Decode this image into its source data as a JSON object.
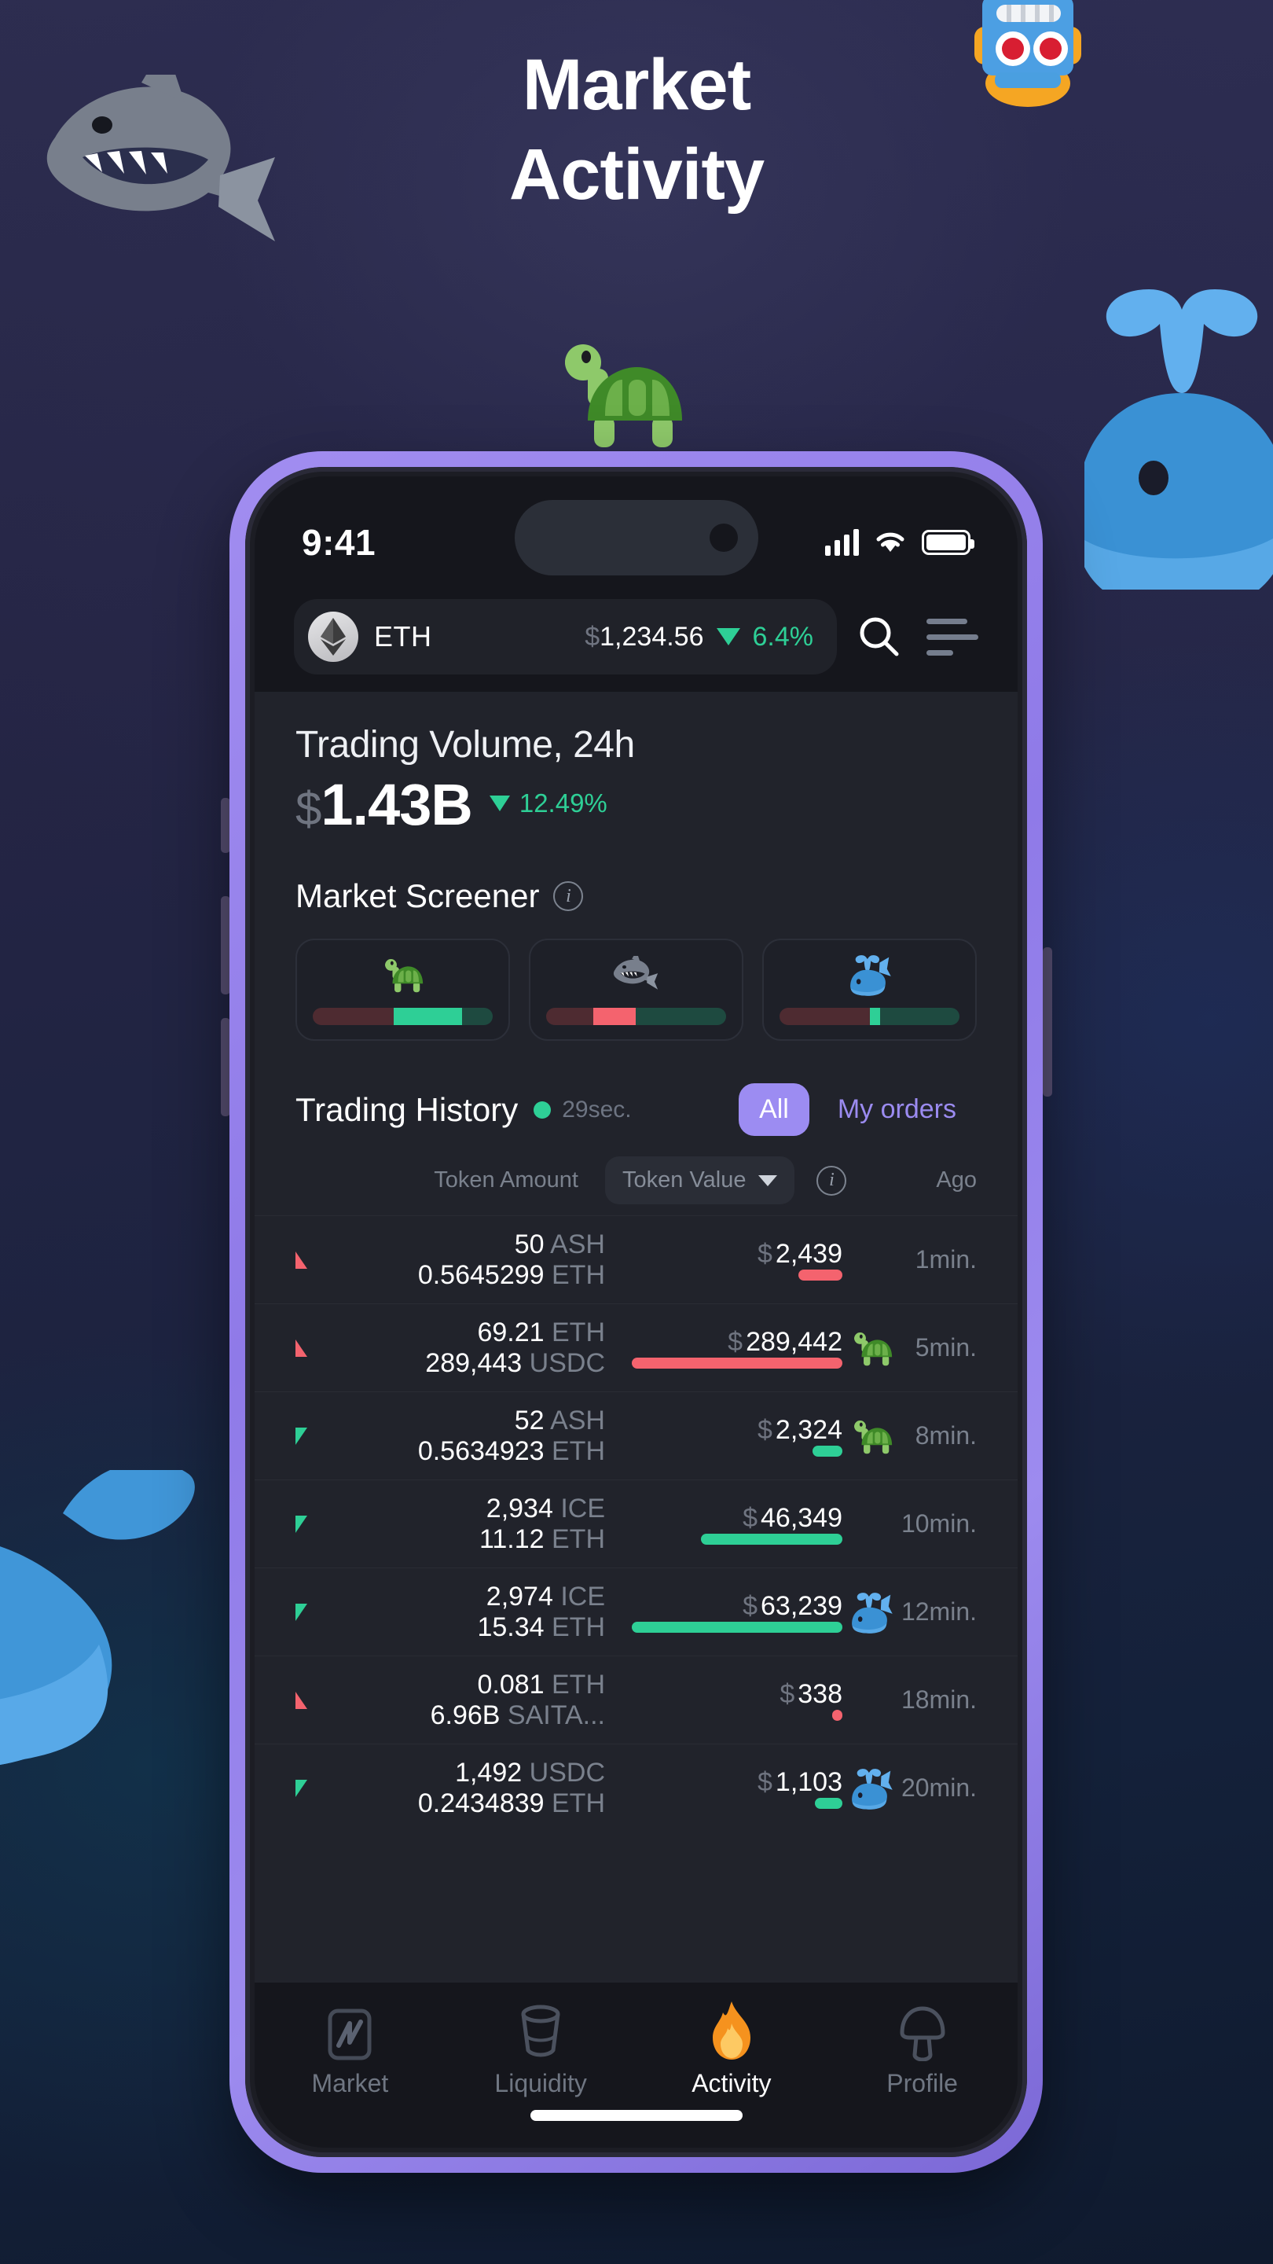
{
  "headline": {
    "line1": "Market",
    "line2": "Activity"
  },
  "decor": {
    "shark": "shark-illustration",
    "whale_right": "whale-illustration",
    "whale_left": "whale-illustration",
    "robot": "robot-illustration",
    "turtle": "turtle-illustration"
  },
  "colors": {
    "accent_purple": "#9c8cf2",
    "positive_green": "#2ecf96",
    "negative_red": "#f4636e",
    "screen_bg": "#21232b",
    "bar_bg": "#15161c"
  },
  "status_bar": {
    "time": "9:41",
    "signal": "cellular-bars-icon",
    "wifi": "wifi-icon",
    "battery": "battery-full-icon"
  },
  "top_bar": {
    "token_symbol": "ETH",
    "token_icon": "ethereum-icon",
    "currency": "$",
    "price": "1,234.56",
    "change": "6.4%",
    "change_direction": "down",
    "search_icon": "search-icon",
    "menu_icon": "hamburger-menu-icon"
  },
  "volume": {
    "title": "Trading Volume, 24h",
    "currency": "$",
    "value": "1.43B",
    "delta": "12.49%",
    "delta_direction": "down"
  },
  "screener": {
    "title": "Market Screener",
    "info_icon": "info-icon",
    "cards": [
      {
        "emoji": "turtle-icon",
        "neg_pct": 45,
        "hot_pct": 38,
        "hot_color": "#2ecf96",
        "pos_pct": 17
      },
      {
        "emoji": "shark-icon",
        "neg_pct": 26,
        "hot_pct": 24,
        "hot_color": "#f4636e",
        "pos_pct": 50
      },
      {
        "emoji": "whale-icon",
        "neg_pct": 50,
        "hot_pct": 6,
        "hot_color": "#2ecf96",
        "pos_pct": 44
      }
    ]
  },
  "history": {
    "title": "Trading History",
    "live_dot": "live-indicator",
    "timer": "29sec.",
    "tabs": [
      {
        "label": "All",
        "active": true
      },
      {
        "label": "My orders",
        "active": false
      }
    ],
    "columns": {
      "amount": "Token Amount",
      "value": "Token Value",
      "value_chevron": "chevron-down-icon",
      "info": "info-icon",
      "ago": "Ago"
    },
    "rows": [
      {
        "direction": "up",
        "amount_top": "50",
        "symbol_top": "ASH",
        "amount_bottom": "0.5645299",
        "symbol_bottom": "ETH",
        "currency": "$",
        "value": "2,439",
        "bar_width_pct": 21,
        "bar_color": "#f4636e",
        "creature": "",
        "ago": "1min."
      },
      {
        "direction": "up",
        "amount_top": "69.21",
        "symbol_top": "ETH",
        "amount_bottom": "289,443",
        "symbol_bottom": "USDC",
        "currency": "$",
        "value": "289,442",
        "bar_width_pct": 100,
        "bar_color": "#f4636e",
        "creature": "turtle-icon",
        "ago": "5min."
      },
      {
        "direction": "down",
        "amount_top": "52",
        "symbol_top": "ASH",
        "amount_bottom": "0.5634923",
        "symbol_bottom": "ETH",
        "currency": "$",
        "value": "2,324",
        "bar_width_pct": 14,
        "bar_color": "#2ecf96",
        "creature": "turtle-icon",
        "ago": "8min."
      },
      {
        "direction": "down",
        "amount_top": "2,934",
        "symbol_top": "ICE",
        "amount_bottom": "11.12",
        "symbol_bottom": "ETH",
        "currency": "$",
        "value": "46,349",
        "bar_width_pct": 67,
        "bar_color": "#2ecf96",
        "creature": "",
        "ago": "10min."
      },
      {
        "direction": "down",
        "amount_top": "2,974",
        "symbol_top": "ICE",
        "amount_bottom": "15.34",
        "symbol_bottom": "ETH",
        "currency": "$",
        "value": "63,239",
        "bar_width_pct": 100,
        "bar_color": "#2ecf96",
        "creature": "whale-icon",
        "ago": "12min."
      },
      {
        "direction": "up",
        "amount_top": "0.081",
        "symbol_top": "ETH",
        "amount_bottom": "6.96B",
        "symbol_bottom": "SAITA...",
        "currency": "$",
        "value": "338",
        "bar_width_pct": 5,
        "bar_color": "#f4636e",
        "creature": "",
        "ago": "18min."
      },
      {
        "direction": "down",
        "amount_top": "1,492",
        "symbol_top": "USDC",
        "amount_bottom": "0.2434839",
        "symbol_bottom": "ETH",
        "currency": "$",
        "value": "1,103",
        "bar_width_pct": 13,
        "bar_color": "#2ecf96",
        "creature": "whale-icon",
        "ago": "20min."
      }
    ]
  },
  "tabbar": {
    "items": [
      {
        "label": "Market",
        "icon": "chart-icon",
        "active": false
      },
      {
        "label": "Liquidity",
        "icon": "cup-icon",
        "active": false
      },
      {
        "label": "Activity",
        "icon": "fire-icon",
        "active": true
      },
      {
        "label": "Profile",
        "icon": "mushroom-icon",
        "active": false
      }
    ]
  }
}
